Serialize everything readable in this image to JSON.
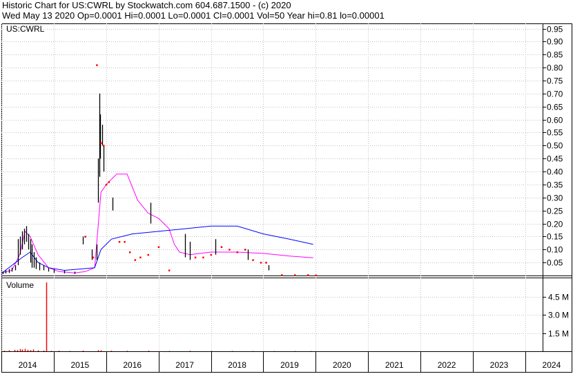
{
  "header": {
    "line1": "Historic Chart for US:CWRL by Stockwatch.com 604.687.1500 - (c) 2020",
    "line2": "Wed May 13 2020   Op=0.0001  Hi=0.0001  Lo=0.0001  Cl=0.0001  Vol=50  Year hi=0.81  lo=0.00001"
  },
  "colors": {
    "price": "#000000",
    "close_dot": "#ff0000",
    "ma_short": "#ff00ff",
    "ma_long": "#0000ff",
    "volume": "#ff0000",
    "grid": "#c0c0c0"
  },
  "chart_data": [
    {
      "type": "line",
      "title": "US:CWRL",
      "price_axis": {
        "ylim": [
          0,
          0.97
        ],
        "ticks": [
          "0.95",
          "0.90",
          "0.85",
          "0.80",
          "0.75",
          "0.70",
          "0.65",
          "0.60",
          "0.55",
          "0.50",
          "0.45",
          "0.40",
          "0.35",
          "0.30",
          "0.25",
          "0.20",
          "0.15",
          "0.10",
          "0.05"
        ],
        "tick_values": [
          0.95,
          0.9,
          0.85,
          0.8,
          0.75,
          0.7,
          0.65,
          0.6,
          0.55,
          0.5,
          0.45,
          0.4,
          0.35,
          0.3,
          0.25,
          0.2,
          0.15,
          0.1,
          0.05
        ]
      },
      "x_axis": {
        "xlim": [
          2014.0,
          2024.33
        ],
        "ticks": [
          "2014",
          "2015",
          "2016",
          "2017",
          "2018",
          "2019",
          "2020",
          "2021",
          "2022",
          "2023",
          "2024"
        ]
      },
      "bars": [
        {
          "x": 2014.02,
          "hi": 0.015,
          "lo": 0.005
        },
        {
          "x": 2014.08,
          "hi": 0.02,
          "lo": 0.008
        },
        {
          "x": 2014.14,
          "hi": 0.025,
          "lo": 0.01
        },
        {
          "x": 2014.2,
          "hi": 0.03,
          "lo": 0.015
        },
        {
          "x": 2014.26,
          "hi": 0.04,
          "lo": 0.02
        },
        {
          "x": 2014.32,
          "hi": 0.14,
          "lo": 0.04
        },
        {
          "x": 2014.36,
          "hi": 0.15,
          "lo": 0.08
        },
        {
          "x": 2014.4,
          "hi": 0.17,
          "lo": 0.1
        },
        {
          "x": 2014.44,
          "hi": 0.18,
          "lo": 0.12
        },
        {
          "x": 2014.48,
          "hi": 0.19,
          "lo": 0.13
        },
        {
          "x": 2014.52,
          "hi": 0.16,
          "lo": 0.1
        },
        {
          "x": 2014.55,
          "hi": 0.14,
          "lo": 0.05
        },
        {
          "x": 2014.58,
          "hi": 0.12,
          "lo": 0.03
        },
        {
          "x": 2014.62,
          "hi": 0.09,
          "lo": 0.03
        },
        {
          "x": 2014.66,
          "hi": 0.07,
          "lo": 0.025
        },
        {
          "x": 2014.72,
          "hi": 0.05,
          "lo": 0.02
        },
        {
          "x": 2014.8,
          "hi": 0.04,
          "lo": 0.02
        },
        {
          "x": 2014.9,
          "hi": 0.03,
          "lo": 0.015
        },
        {
          "x": 2015.0,
          "hi": 0.025,
          "lo": 0.01
        },
        {
          "x": 2015.2,
          "hi": 0.02,
          "lo": 0.008
        },
        {
          "x": 2015.4,
          "hi": 0.015,
          "lo": 0.006
        },
        {
          "x": 2015.55,
          "hi": 0.15,
          "lo": 0.12
        },
        {
          "x": 2015.72,
          "hi": 0.1,
          "lo": 0.06
        },
        {
          "x": 2015.82,
          "hi": 0.12,
          "lo": 0.06
        },
        {
          "x": 2015.85,
          "hi": 0.45,
          "lo": 0.28
        },
        {
          "x": 2015.87,
          "hi": 0.7,
          "lo": 0.38
        },
        {
          "x": 2015.89,
          "hi": 0.62,
          "lo": 0.45
        },
        {
          "x": 2015.92,
          "hi": 0.58,
          "lo": 0.5
        },
        {
          "x": 2015.95,
          "hi": 0.5,
          "lo": 0.4
        },
        {
          "x": 2016.12,
          "hi": 0.3,
          "lo": 0.25
        },
        {
          "x": 2016.85,
          "hi": 0.28,
          "lo": 0.2
        },
        {
          "x": 2017.5,
          "hi": 0.16,
          "lo": 0.07
        },
        {
          "x": 2017.6,
          "hi": 0.13,
          "lo": 0.06
        },
        {
          "x": 2018.08,
          "hi": 0.14,
          "lo": 0.08
        },
        {
          "x": 2018.7,
          "hi": 0.1,
          "lo": 0.06
        },
        {
          "x": 2019.1,
          "hi": 0.04,
          "lo": 0.02
        }
      ],
      "closes": [
        {
          "x": 2015.82,
          "y": 0.81
        },
        {
          "x": 2015.95,
          "y": 0.5
        },
        {
          "x": 2015.9,
          "y": 0.51
        },
        {
          "x": 2016.05,
          "y": 0.36
        },
        {
          "x": 2016.0,
          "y": 0.35
        },
        {
          "x": 2015.75,
          "y": 0.07
        },
        {
          "x": 2015.6,
          "y": 0.15
        },
        {
          "x": 2016.25,
          "y": 0.13
        },
        {
          "x": 2016.35,
          "y": 0.13
        },
        {
          "x": 2016.45,
          "y": 0.09
        },
        {
          "x": 2016.55,
          "y": 0.06
        },
        {
          "x": 2016.65,
          "y": 0.07
        },
        {
          "x": 2016.8,
          "y": 0.08
        },
        {
          "x": 2017.0,
          "y": 0.11
        },
        {
          "x": 2017.2,
          "y": 0.02
        },
        {
          "x": 2017.7,
          "y": 0.07
        },
        {
          "x": 2017.85,
          "y": 0.07
        },
        {
          "x": 2018.0,
          "y": 0.08
        },
        {
          "x": 2018.2,
          "y": 0.11
        },
        {
          "x": 2018.35,
          "y": 0.1
        },
        {
          "x": 2018.5,
          "y": 0.09
        },
        {
          "x": 2018.65,
          "y": 0.1
        },
        {
          "x": 2018.8,
          "y": 0.06
        },
        {
          "x": 2018.95,
          "y": 0.05
        },
        {
          "x": 2019.05,
          "y": 0.05
        },
        {
          "x": 2019.35,
          "y": 0.002
        },
        {
          "x": 2019.6,
          "y": 0.002
        },
        {
          "x": 2019.85,
          "y": 0.002
        },
        {
          "x": 2020.0,
          "y": 0.001
        }
      ],
      "series": [
        {
          "name": "",
          "values": [
            [
              2014.0,
              0.01
            ],
            [
              2014.2,
              0.02
            ],
            [
              2014.35,
              0.08
            ],
            [
              2014.45,
              0.17
            ],
            [
              2014.55,
              0.15
            ],
            [
              2014.7,
              0.08
            ],
            [
              2014.9,
              0.03
            ],
            [
              2015.1,
              0.015
            ],
            [
              2015.4,
              0.01
            ],
            [
              2015.6,
              0.015
            ],
            [
              2015.78,
              0.03
            ],
            [
              2015.83,
              0.15
            ],
            [
              2015.9,
              0.32
            ],
            [
              2016.0,
              0.35
            ],
            [
              2016.2,
              0.39
            ],
            [
              2016.4,
              0.39
            ],
            [
              2016.5,
              0.34
            ],
            [
              2016.6,
              0.29
            ],
            [
              2016.8,
              0.24
            ],
            [
              2017.0,
              0.22
            ],
            [
              2017.1,
              0.2
            ],
            [
              2017.2,
              0.18
            ],
            [
              2017.3,
              0.12
            ],
            [
              2017.4,
              0.09
            ],
            [
              2017.6,
              0.08
            ],
            [
              2018.0,
              0.09
            ],
            [
              2018.5,
              0.09
            ],
            [
              2019.0,
              0.085
            ],
            [
              2019.5,
              0.075
            ],
            [
              2019.95,
              0.068
            ]
          ]
        },
        {
          "name": "",
          "values": [
            [
              2014.0,
              0.008
            ],
            [
              2014.4,
              0.07
            ],
            [
              2014.55,
              0.09
            ],
            [
              2014.7,
              0.05
            ],
            [
              2014.9,
              0.03
            ],
            [
              2015.2,
              0.02
            ],
            [
              2015.5,
              0.025
            ],
            [
              2015.78,
              0.03
            ],
            [
              2015.9,
              0.1
            ],
            [
              2016.1,
              0.14
            ],
            [
              2016.5,
              0.16
            ],
            [
              2017.0,
              0.17
            ],
            [
              2017.5,
              0.18
            ],
            [
              2018.0,
              0.19
            ],
            [
              2018.5,
              0.19
            ],
            [
              2019.0,
              0.16
            ],
            [
              2019.5,
              0.14
            ],
            [
              2019.95,
              0.12
            ]
          ]
        }
      ]
    },
    {
      "type": "bar",
      "title": "Volume",
      "y_axis": {
        "ylim": [
          0,
          6.1
        ],
        "ticks": [
          "4.5 M",
          "3.0 M",
          "1.5 M"
        ],
        "tick_values": [
          4.5,
          3.0,
          1.5
        ]
      },
      "bars": [
        {
          "x": 2014.05,
          "v": 0.05
        },
        {
          "x": 2014.15,
          "v": 0.08
        },
        {
          "x": 2014.25,
          "v": 0.12
        },
        {
          "x": 2014.3,
          "v": 0.1
        },
        {
          "x": 2014.35,
          "v": 0.18
        },
        {
          "x": 2014.4,
          "v": 0.15
        },
        {
          "x": 2014.45,
          "v": 0.2
        },
        {
          "x": 2014.5,
          "v": 0.12
        },
        {
          "x": 2014.55,
          "v": 0.1
        },
        {
          "x": 2014.6,
          "v": 0.15
        },
        {
          "x": 2014.7,
          "v": 0.08
        },
        {
          "x": 2014.8,
          "v": 0.06
        },
        {
          "x": 2014.86,
          "v": 5.7
        },
        {
          "x": 2014.95,
          "v": 0.04
        },
        {
          "x": 2015.1,
          "v": 0.05
        },
        {
          "x": 2015.3,
          "v": 0.03
        },
        {
          "x": 2015.55,
          "v": 0.06
        },
        {
          "x": 2015.85,
          "v": 0.09
        },
        {
          "x": 2015.9,
          "v": 0.07
        },
        {
          "x": 2016.1,
          "v": 0.05
        },
        {
          "x": 2016.4,
          "v": 0.04
        },
        {
          "x": 2016.8,
          "v": 0.05
        },
        {
          "x": 2017.2,
          "v": 0.03
        },
        {
          "x": 2017.6,
          "v": 0.04
        },
        {
          "x": 2018.0,
          "v": 0.03
        },
        {
          "x": 2018.4,
          "v": 0.03
        },
        {
          "x": 2018.8,
          "v": 0.02
        },
        {
          "x": 2019.2,
          "v": 0.02
        },
        {
          "x": 2019.6,
          "v": 0.02
        },
        {
          "x": 2019.9,
          "v": 0.02
        }
      ]
    }
  ]
}
